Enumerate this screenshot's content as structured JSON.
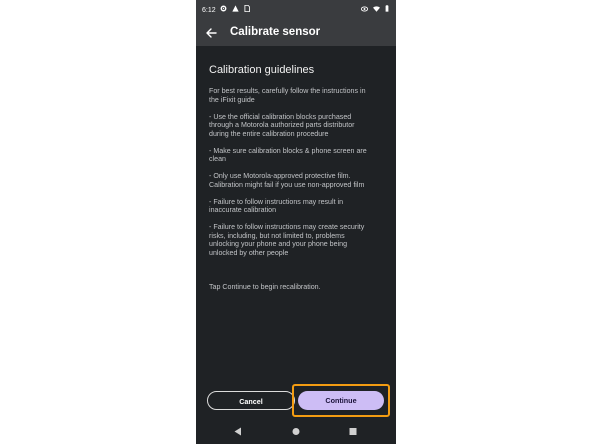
{
  "status_bar": {
    "time": "6:12",
    "left_icons": [
      "gear-icon",
      "warning-icon",
      "sim-icon"
    ],
    "right_icons": [
      "eye-icon",
      "wifi-icon",
      "battery-icon"
    ]
  },
  "app_bar": {
    "title": "Calibrate sensor",
    "back_icon": "arrow-left-icon"
  },
  "content": {
    "heading": "Calibration guidelines",
    "paragraphs": [
      "For best results, carefully follow the instructions in\nthe iFixit guide",
      "- Use the official calibration blocks purchased\nthrough a Motorola authorized parts distributor\nduring the entire calibration procedure",
      "- Make sure calibration blocks & phone screen are\nclean",
      "- Only use Motorola-approved protective film.\nCalibration might fail if you use non-approved film",
      "- Failure to follow instructions may result in\ninaccurate calibration",
      "- Failure to follow instructions may create security\nrisks, including, but not limited to, problems\nunlocking your phone and your phone being\nunlocked by other people",
      "",
      "Tap Continue to begin recalibration."
    ]
  },
  "buttons": {
    "cancel": "Cancel",
    "continue": "Continue"
  },
  "nav_bar": {
    "items": [
      "back-triangle-icon",
      "home-circle-icon",
      "recents-square-icon"
    ]
  },
  "colors": {
    "screen_bg": "#1f2225",
    "app_bar_bg": "#3a3c3f",
    "primary_button": "#cdbdf5",
    "highlight": "#f39c12"
  }
}
